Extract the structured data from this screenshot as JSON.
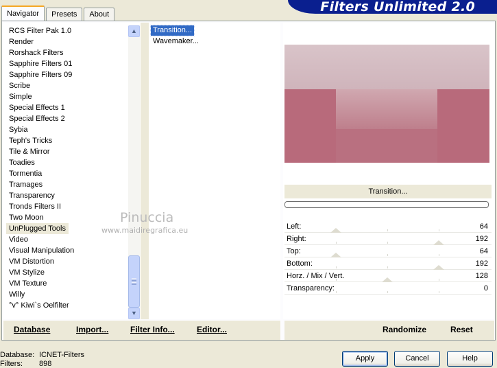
{
  "tabs": [
    {
      "label": "Navigator",
      "active": true
    },
    {
      "label": "Presets",
      "active": false
    },
    {
      "label": "About",
      "active": false
    }
  ],
  "banner_title": "Filters Unlimited 2.0",
  "categories": [
    "RCS Filter Pak 1.0",
    "Render",
    "Rorshack Filters",
    "Sapphire Filters 01",
    "Sapphire Filters 09",
    "Scribe",
    "Simple",
    "Special Effects 1",
    "Special Effects 2",
    "Sybia",
    "Teph's Tricks",
    "Tile & Mirror",
    "Toadies",
    "Tormentia",
    "Tramages",
    "Transparency",
    "Tronds Filters II",
    "Two Moon",
    "UnPlugged Tools",
    "Video",
    "Visual Manipulation",
    "VM Distortion",
    "VM Stylize",
    "VM Texture",
    "Willy",
    "°v° Kiwi`s Oelfilter"
  ],
  "selected_category": "UnPlugged Tools",
  "filters": [
    "Transition...",
    "Wavemaker..."
  ],
  "selected_filter": "Transition...",
  "filter_name": "Transition...",
  "params": [
    {
      "label": "Left:",
      "value": "64"
    },
    {
      "label": "Right:",
      "value": "192"
    },
    {
      "label": "Top:",
      "value": "64"
    },
    {
      "label": "Bottom:",
      "value": "192"
    },
    {
      "label": "Horz. / Mix / Vert.",
      "value": "128"
    },
    {
      "label": "Transparency:",
      "value": "0"
    }
  ],
  "left_links": {
    "database": "Database",
    "import": "Import...",
    "filter_info": "Filter Info...",
    "editor": "Editor..."
  },
  "right_links": {
    "randomize": "Randomize",
    "reset": "Reset"
  },
  "watermark": {
    "name": "Pinuccia",
    "url": "www.maidiregrafica.eu"
  },
  "status": {
    "database_label": "Database:",
    "database_value": "ICNET-Filters",
    "filters_label": "Filters:",
    "filters_value": "898"
  },
  "buttons": {
    "apply": "Apply",
    "cancel": "Cancel",
    "help": "Help"
  },
  "icons": {
    "scroll_up": "chevron-up-icon",
    "scroll_down": "chevron-down-icon"
  },
  "colors": {
    "banner": "#0a1f8f",
    "selection": "#316ac5",
    "preview_rose": "#b86a7b",
    "preview_light": "#d9c4c9"
  }
}
